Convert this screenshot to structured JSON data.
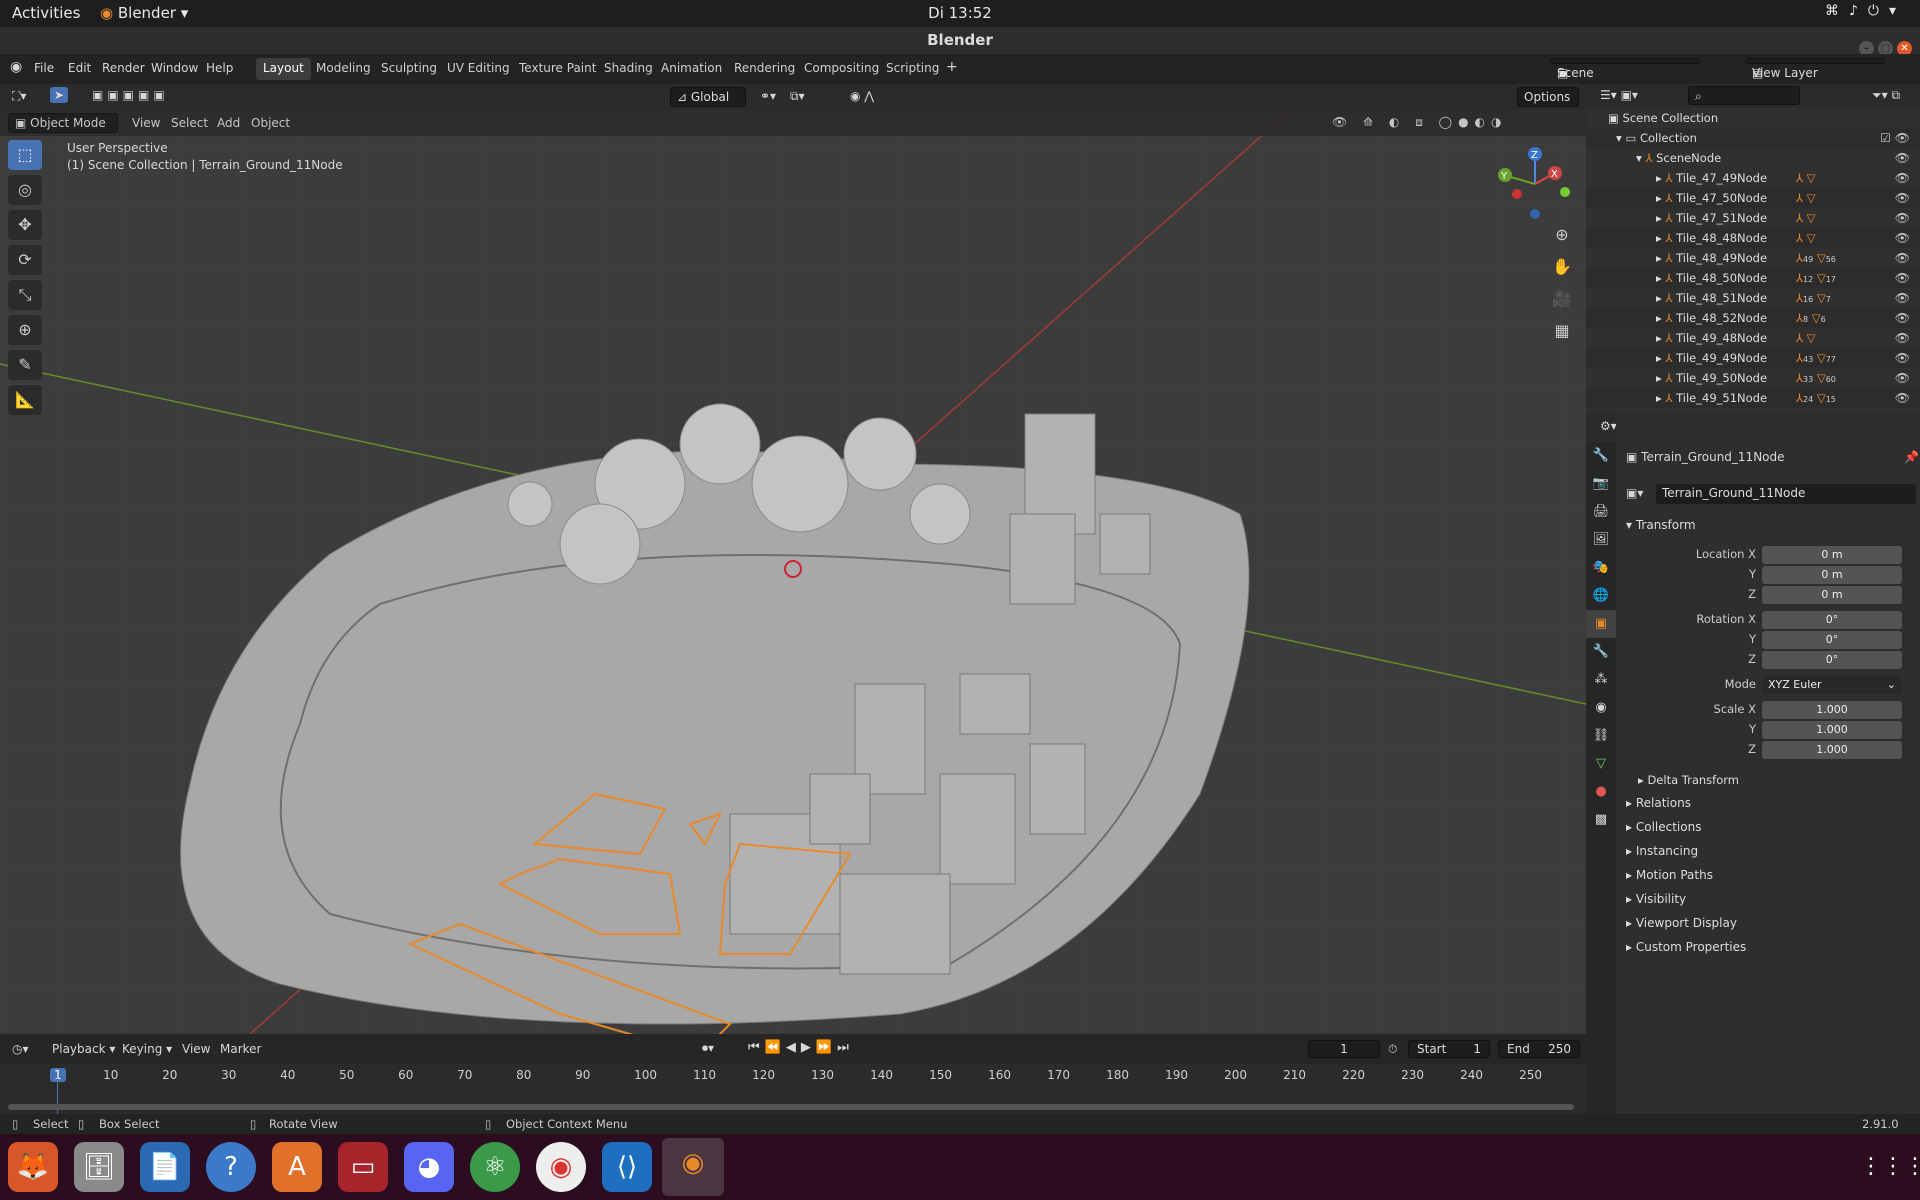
{
  "system": {
    "activities": "Activities",
    "app_menu": "Blender",
    "clock": "Di 13:52"
  },
  "window": {
    "title": "Blender"
  },
  "menu": {
    "file": "File",
    "edit": "Edit",
    "render": "Render",
    "window": "Window",
    "help": "Help"
  },
  "workspaces": [
    "Layout",
    "Modeling",
    "Sculpting",
    "UV Editing",
    "Texture Paint",
    "Shading",
    "Animation",
    "Rendering",
    "Compositing",
    "Scripting"
  ],
  "scene": {
    "name": "Scene",
    "view_layer": "View Layer"
  },
  "toolbar": {
    "transform_orientation": "Global",
    "options": "Options"
  },
  "viewport": {
    "mode": "Object Mode",
    "view": "View",
    "select": "Select",
    "add": "Add",
    "object": "Object",
    "perspective": "User Perspective",
    "context": "(1) Scene Collection | Terrain_Ground_11Node"
  },
  "outliner": {
    "scene_collection": "Scene Collection",
    "collection": "Collection",
    "scene_node": "SceneNode",
    "tiles": [
      {
        "name": "Tile_47_49Node",
        "c1": "",
        "c2": ""
      },
      {
        "name": "Tile_47_50Node",
        "c1": "",
        "c2": ""
      },
      {
        "name": "Tile_47_51Node",
        "c1": "",
        "c2": ""
      },
      {
        "name": "Tile_48_48Node",
        "c1": "",
        "c2": ""
      },
      {
        "name": "Tile_48_49Node",
        "c1": "49",
        "c2": "56"
      },
      {
        "name": "Tile_48_50Node",
        "c1": "12",
        "c2": "17"
      },
      {
        "name": "Tile_48_51Node",
        "c1": "16",
        "c2": "7"
      },
      {
        "name": "Tile_48_52Node",
        "c1": "8",
        "c2": "6"
      },
      {
        "name": "Tile_49_48Node",
        "c1": "",
        "c2": ""
      },
      {
        "name": "Tile_49_49Node",
        "c1": "43",
        "c2": "77"
      },
      {
        "name": "Tile_49_50Node",
        "c1": "33",
        "c2": "60"
      },
      {
        "name": "Tile_49_51Node",
        "c1": "24",
        "c2": "15"
      }
    ]
  },
  "properties": {
    "object_name": "Terrain_Ground_11Node",
    "data_name": "Terrain_Ground_11Node",
    "transform": "Transform",
    "loc_label": "Location X",
    "rot_label": "Rotation X",
    "scale_label": "Scale X",
    "y": "Y",
    "z": "Z",
    "loc": [
      "0 m",
      "0 m",
      "0 m"
    ],
    "rot": [
      "0°",
      "0°",
      "0°"
    ],
    "mode_label": "Mode",
    "mode": "XYZ Euler",
    "scale": [
      "1.000",
      "1.000",
      "1.000"
    ],
    "delta": "Delta Transform",
    "sections": [
      "Relations",
      "Collections",
      "Instancing",
      "Motion Paths",
      "Visibility",
      "Viewport Display",
      "Custom Properties"
    ]
  },
  "timeline": {
    "playback": "Playback",
    "keying": "Keying",
    "view": "View",
    "marker": "Marker",
    "current": "1",
    "start_label": "Start",
    "start": "1",
    "end_label": "End",
    "end": "250",
    "ticks": [
      "1",
      "10",
      "20",
      "30",
      "40",
      "50",
      "60",
      "70",
      "80",
      "90",
      "100",
      "110",
      "120",
      "130",
      "140",
      "150",
      "160",
      "170",
      "180",
      "190",
      "200",
      "210",
      "220",
      "230",
      "240",
      "250"
    ]
  },
  "status": {
    "select": "Select",
    "box_select": "Box Select",
    "rotate": "Rotate View",
    "context": "Object Context Menu",
    "version": "2.91.0"
  },
  "colors": {
    "accent": "#4772b3",
    "selection": "#e8892a",
    "dock": "#2c0d1f"
  }
}
